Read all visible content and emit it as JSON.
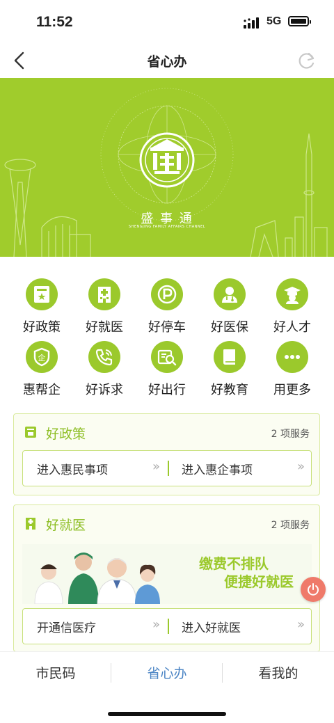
{
  "status": {
    "time": "11:52",
    "network": "5G"
  },
  "nav": {
    "title": "省心办"
  },
  "banner": {
    "brand": "盛 事 通",
    "tagline": "SHENGJING FAMILY AFFAIRS CHANNEL",
    "accent": "#a0cc2c"
  },
  "grid": [
    {
      "label": "好政策",
      "icon": "policy-icon"
    },
    {
      "label": "好就医",
      "icon": "hospital-icon"
    },
    {
      "label": "好停车",
      "icon": "parking-icon"
    },
    {
      "label": "好医保",
      "icon": "doctor-icon"
    },
    {
      "label": "好人才",
      "icon": "graduate-icon"
    },
    {
      "label": "惠帮企",
      "icon": "enterprise-shield-icon"
    },
    {
      "label": "好诉求",
      "icon": "phone-icon"
    },
    {
      "label": "好出行",
      "icon": "travel-search-icon"
    },
    {
      "label": "好教育",
      "icon": "book-icon"
    },
    {
      "label": "用更多",
      "icon": "more-icon"
    }
  ],
  "cards": [
    {
      "title": "好政策",
      "count": "2 项服务",
      "icon": "policy-icon",
      "links": [
        {
          "label": "进入惠民事项",
          "arrow": "»"
        },
        {
          "label": "进入惠企事项",
          "arrow": "»"
        }
      ]
    },
    {
      "title": "好就医",
      "count": "2 项服务",
      "icon": "hospital-icon",
      "promo": [
        "缴费不排队",
        "便捷好就医"
      ],
      "links": [
        {
          "label": "开通信医疗",
          "arrow": "»"
        },
        {
          "label": "进入好就医",
          "arrow": "»"
        }
      ]
    }
  ],
  "tabs": [
    {
      "label": "市民码"
    },
    {
      "label": "省心办",
      "active": true
    },
    {
      "label": "看我的"
    }
  ],
  "colors": {
    "green": "#9bc92c",
    "active_tab": "#4a84c4",
    "fab": "#ef7a6a"
  }
}
